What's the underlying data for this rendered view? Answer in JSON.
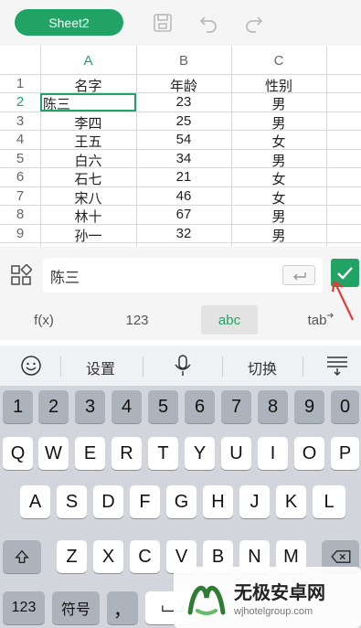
{
  "toolbar": {
    "sheet_label": "Sheet2",
    "icons": [
      "save-icon",
      "undo-icon",
      "redo-icon"
    ]
  },
  "columns": [
    "A",
    "B",
    "C"
  ],
  "rows": [
    {
      "num": "1",
      "a": "名字",
      "b": "年龄",
      "c": "性别"
    },
    {
      "num": "2",
      "a": "陈三",
      "b": "23",
      "c": "男"
    },
    {
      "num": "3",
      "a": "李四",
      "b": "25",
      "c": "男"
    },
    {
      "num": "4",
      "a": "王五",
      "b": "54",
      "c": "女"
    },
    {
      "num": "5",
      "a": "白六",
      "b": "34",
      "c": "男"
    },
    {
      "num": "6",
      "a": "石七",
      "b": "21",
      "c": "女"
    },
    {
      "num": "7",
      "a": "宋八",
      "b": "46",
      "c": "女"
    },
    {
      "num": "8",
      "a": "林十",
      "b": "67",
      "c": "男"
    },
    {
      "num": "9",
      "a": "孙一",
      "b": "32",
      "c": "男"
    }
  ],
  "active": {
    "column": "A",
    "row": "2"
  },
  "edit_bar": {
    "value": "陈三"
  },
  "modes": [
    "f(x)",
    "123",
    "abc",
    "tab"
  ],
  "active_mode": "abc",
  "ime": {
    "settings": "设置",
    "switch": "切换"
  },
  "keyboard": {
    "row_numbers": [
      "1",
      "2",
      "3",
      "4",
      "5",
      "6",
      "7",
      "8",
      "9",
      "0"
    ],
    "row_top": [
      "Q",
      "W",
      "E",
      "R",
      "T",
      "Y",
      "U",
      "I",
      "O",
      "P"
    ],
    "row_mid": [
      "A",
      "S",
      "D",
      "F",
      "G",
      "H",
      "J",
      "K",
      "L"
    ],
    "row_bot": [
      "Z",
      "X",
      "C",
      "V",
      "B",
      "N",
      "M"
    ],
    "num_key": "123",
    "symbol_key": "符号",
    "comma_key": "，"
  },
  "watermark": {
    "title": "无极安卓网",
    "url": "wjhotelgroup.com"
  },
  "colors": {
    "accent": "#21a366",
    "annotation": "#e53935"
  }
}
